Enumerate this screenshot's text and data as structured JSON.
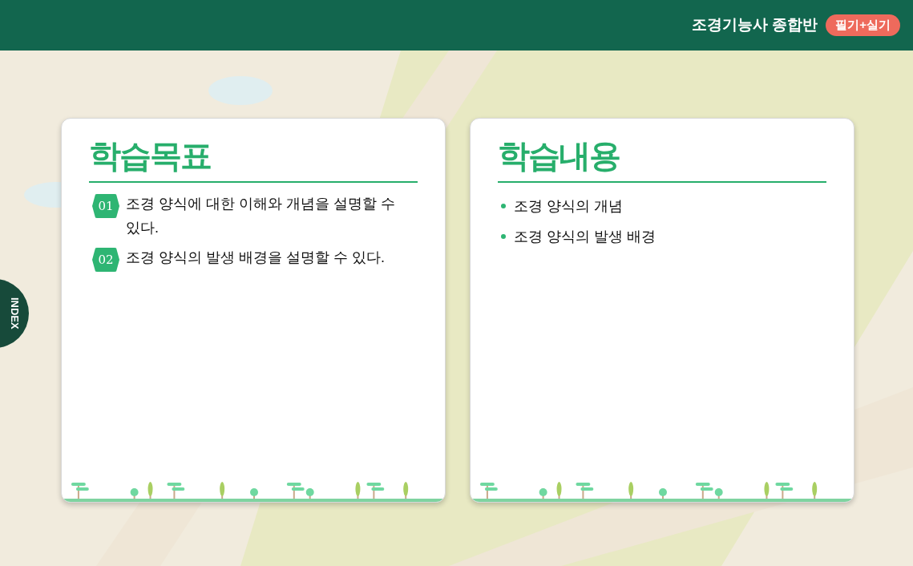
{
  "header": {
    "course_title": "조경기능사 종합반",
    "badge": "필기+실기"
  },
  "index_tab": {
    "label": "INDEX"
  },
  "cards": [
    {
      "title": "학습목표",
      "kind": "numbered",
      "items": [
        {
          "number": "01",
          "text": "조경 양식에 대한 이해와 개념을 설명할 수 있다."
        },
        {
          "number": "02",
          "text": "조경 양식의 발생 배경을 설명할 수 있다."
        }
      ]
    },
    {
      "title": "학습내용",
      "kind": "bulleted",
      "items": [
        {
          "text": "조경 양식의 개념"
        },
        {
          "text": "조경 양식의 발생 배경"
        }
      ]
    }
  ]
}
